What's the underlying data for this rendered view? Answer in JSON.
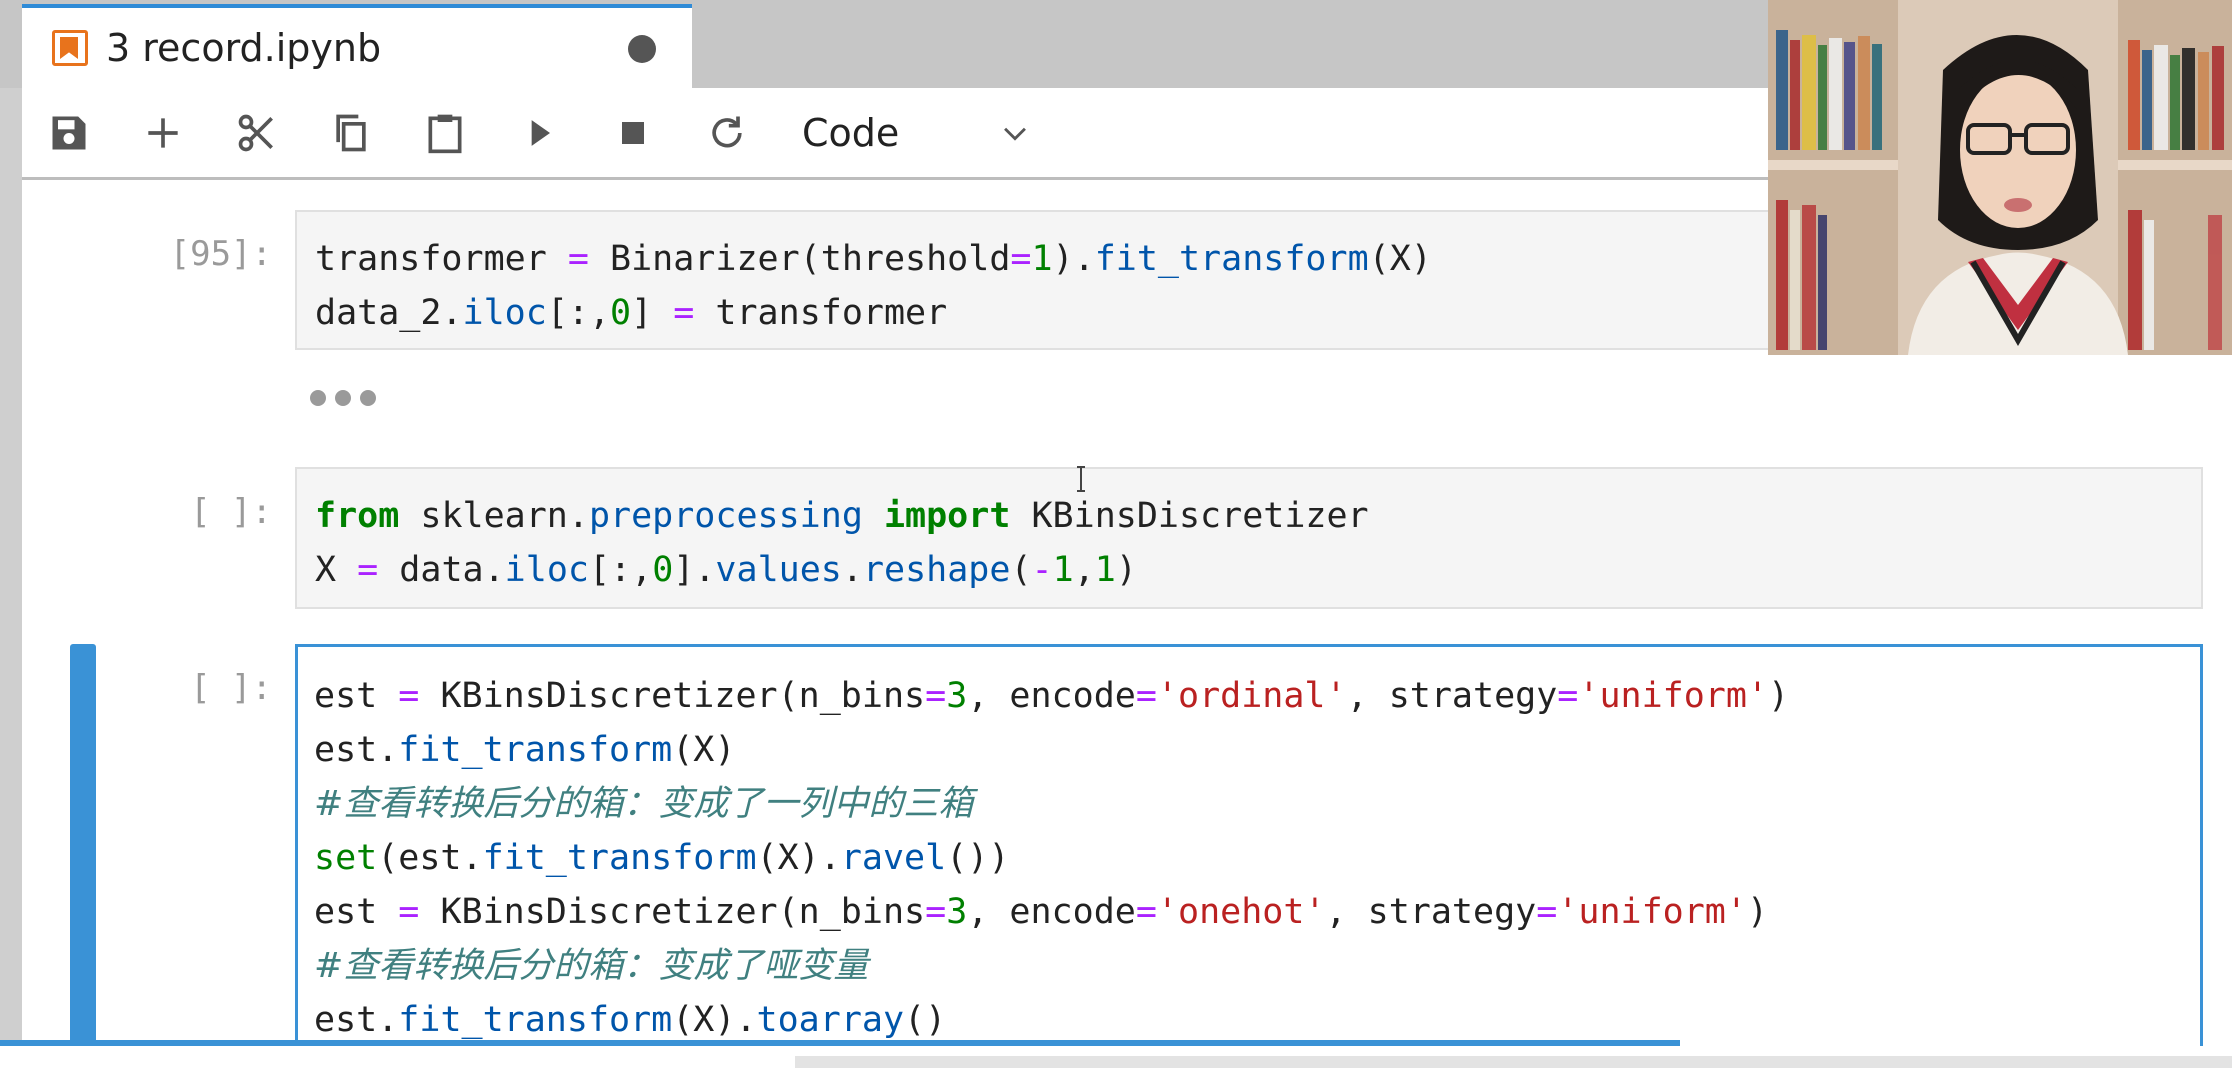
{
  "tab": {
    "title": "3 record.ipynb"
  },
  "toolbar": {
    "buttons": [
      "save-icon",
      "add-icon",
      "cut-icon",
      "copy-icon",
      "paste-icon",
      "run-icon",
      "stop-icon",
      "restart-icon"
    ],
    "cell_type": "Code"
  },
  "cells": [
    {
      "prompt": "[95]:",
      "lines": [
        "transformer = Binarizer(threshold=1).fit_transform(X)",
        "data_2.iloc[:,0] = transformer"
      ]
    },
    {
      "prompt": "[ ]:",
      "lines": [
        "from sklearn.preprocessing import KBinsDiscretizer",
        "X = data.iloc[:,0].values.reshape(-1,1)"
      ]
    },
    {
      "prompt": "[ ]:",
      "lines": [
        "est = KBinsDiscretizer(n_bins=3, encode='ordinal', strategy='uniform')",
        "est.fit_transform(X)",
        "#查看转换后分的箱：变成了一列中的三箱",
        "set(est.fit_transform(X).ravel())",
        "est = KBinsDiscretizer(n_bins=3, encode='onehot', strategy='uniform')",
        "#查看转换后分的箱：变成了哑变量",
        "est.fit_transform(X).toarray()"
      ]
    }
  ],
  "colors": {
    "accent": "#3a92d6",
    "keyword": "#008000",
    "string": "#ba2121",
    "operator": "#aa22ff",
    "comment": "#408080"
  }
}
